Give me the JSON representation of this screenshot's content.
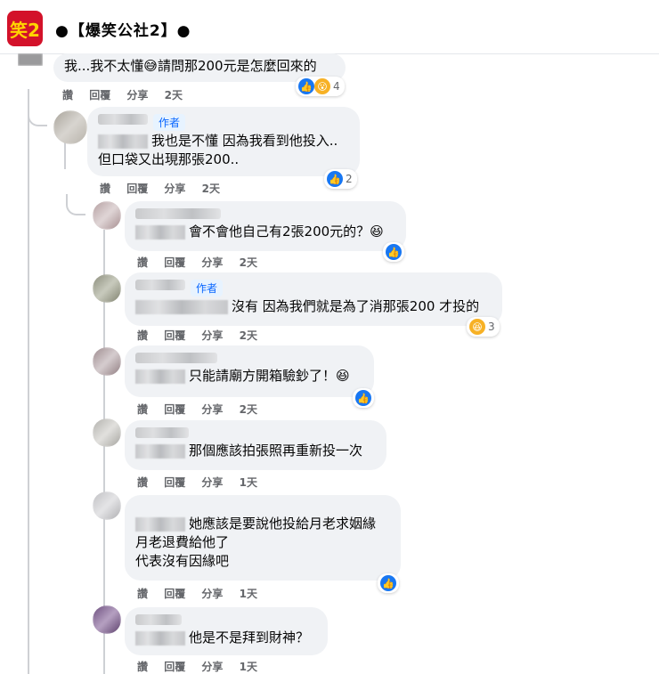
{
  "header": {
    "page_name": "●【爆笑公社2】●",
    "logo_text": "笑2"
  },
  "actions": {
    "like": "讚",
    "reply": "回覆",
    "share": "分享"
  },
  "author_label": "作者",
  "comments": [
    {
      "text": "我...我不太懂😅請問那200元是怎麼回來的",
      "time": "2天",
      "reaction_count": "4"
    },
    {
      "text": "我也是不懂 因為我看到他投入..\n但口袋又出現那張200..",
      "time": "2天",
      "reaction_count": "2"
    },
    {
      "text": "會不會他自己有2張200元的？😆",
      "time": "2天",
      "reaction_count": ""
    },
    {
      "text": "沒有 因為我們就是為了消那張200 才投的",
      "time": "2天",
      "reaction_count": "3"
    },
    {
      "text": "只能請廟方開箱驗鈔了！😆",
      "time": "2天",
      "reaction_count": ""
    },
    {
      "text": "那個應該拍張照再重新投一次",
      "time": "1天",
      "reaction_count": ""
    },
    {
      "text": "她應該是要說他投給月老求姻緣\n月老退費給他了\n代表沒有因緣吧",
      "time": "1天",
      "reaction_count": ""
    },
    {
      "text": "他是不是拜到財神？",
      "time": "1天",
      "reaction_count": ""
    }
  ]
}
